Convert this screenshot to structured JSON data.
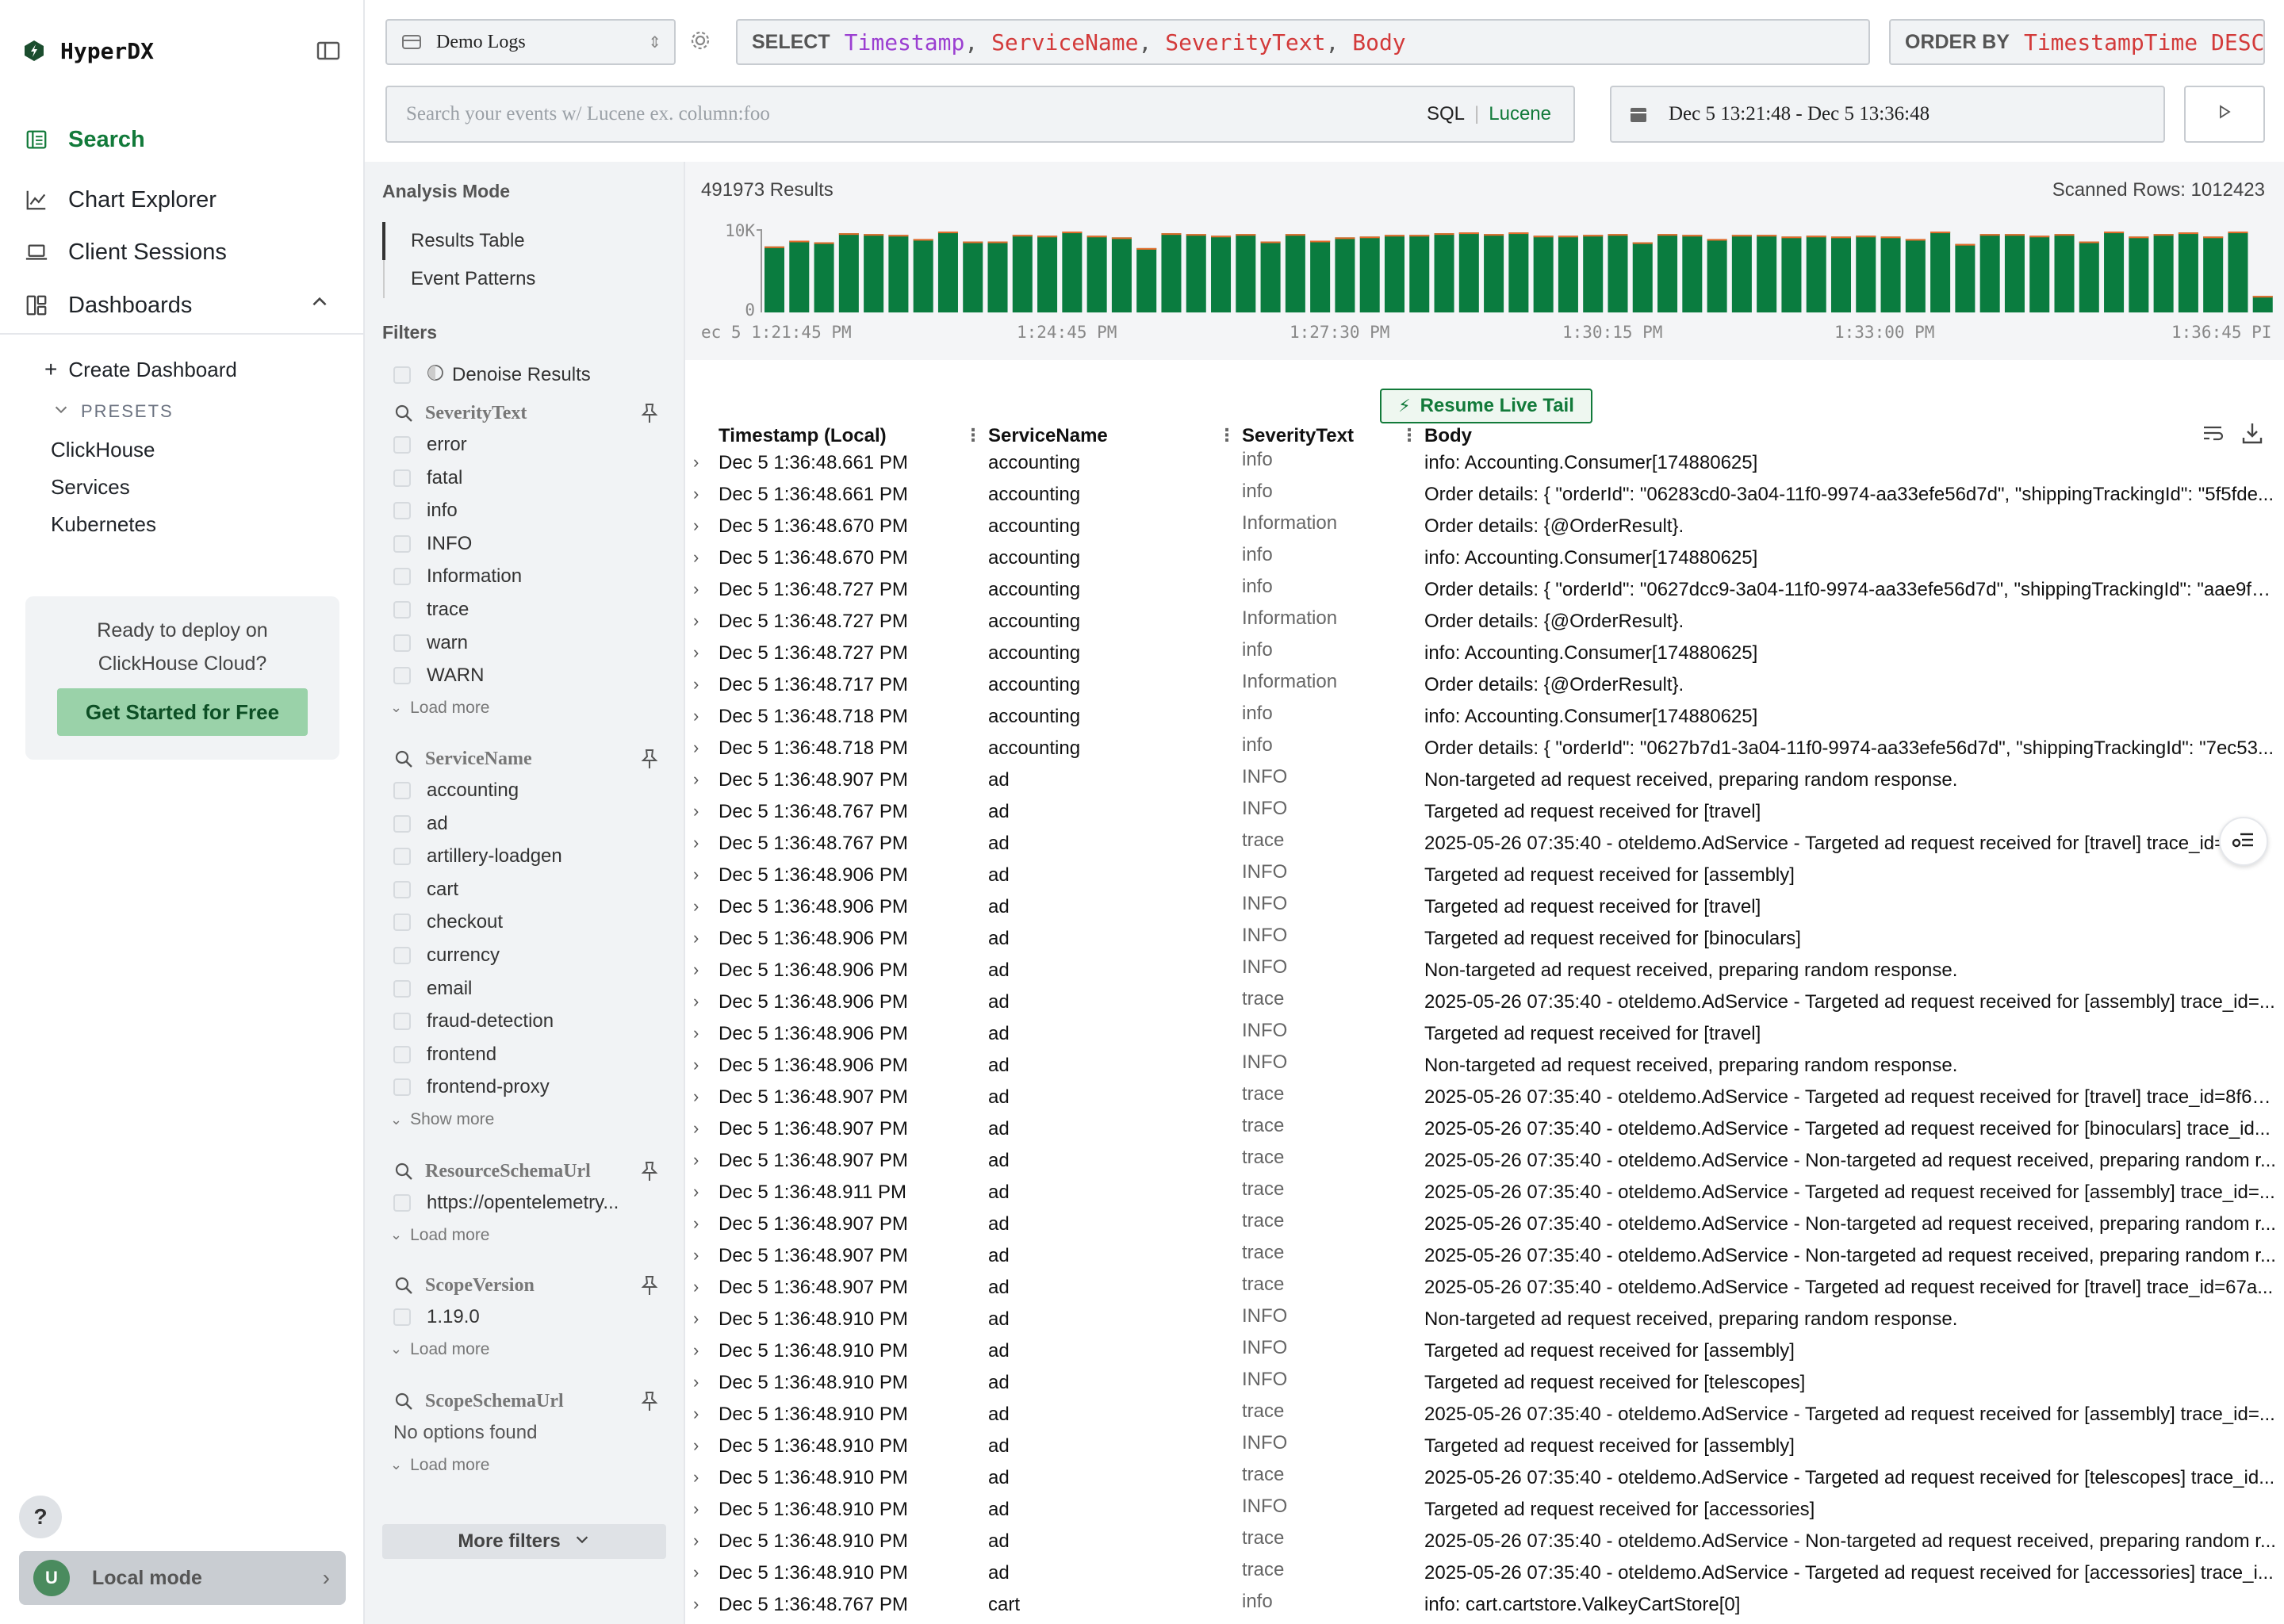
{
  "app": {
    "name": "HyperDX"
  },
  "nav": {
    "items": [
      {
        "label": "Search",
        "active": true
      },
      {
        "label": "Chart Explorer"
      },
      {
        "label": "Client Sessions"
      },
      {
        "label": "Dashboards"
      }
    ],
    "create_dashboard": "Create Dashboard",
    "presets_label": "PRESETS",
    "presets": [
      "ClickHouse",
      "Services",
      "Kubernetes"
    ],
    "deploy_card": {
      "line1": "Ready to deploy on",
      "line2": "ClickHouse Cloud?",
      "button": "Get Started for Free"
    },
    "help": "?",
    "local_mode": {
      "avatar": "U",
      "label": "Local mode"
    }
  },
  "query": {
    "source": "Demo Logs",
    "select_kw": "SELECT",
    "select_fields": [
      "Timestamp",
      "ServiceName",
      "SeverityText",
      "Body"
    ],
    "order_kw": "ORDER BY",
    "order_value": "TimestampTime DESC",
    "search_placeholder": "Search your events w/ Lucene ex. column:foo",
    "lang_sql": "SQL",
    "lang_lucene": "Lucene",
    "time_range": "Dec 5 13:21:48 - Dec 5 13:36:48"
  },
  "filters": {
    "analysis_mode_label": "Analysis Mode",
    "modes": [
      "Results Table",
      "Event Patterns"
    ],
    "filters_label": "Filters",
    "denoise": "Denoise Results",
    "groups": [
      {
        "name": "SeverityText",
        "values": [
          "error",
          "fatal",
          "info",
          "INFO",
          "Information",
          "trace",
          "warn",
          "WARN"
        ],
        "more": "Load more"
      },
      {
        "name": "ServiceName",
        "values": [
          "accounting",
          "ad",
          "artillery-loadgen",
          "cart",
          "checkout",
          "currency",
          "email",
          "fraud-detection",
          "frontend",
          "frontend-proxy"
        ],
        "more": "Show more"
      },
      {
        "name": "ResourceSchemaUrl",
        "values": [
          "https://opentelemetry..."
        ],
        "more": "Load more"
      },
      {
        "name": "ScopeVersion",
        "values": [
          "1.19.0"
        ],
        "more": "Load more"
      },
      {
        "name": "ScopeSchemaUrl",
        "values": [],
        "empty": "No options found",
        "more": "Load more"
      }
    ],
    "more_filters": "More filters"
  },
  "results": {
    "count": "491973 Results",
    "scanned": "Scanned Rows: 1012423",
    "live_tail": "Resume Live Tail",
    "columns": [
      "Timestamp (Local)",
      "ServiceName",
      "SeverityText",
      "Body"
    ]
  },
  "chart_data": {
    "type": "bar",
    "y_tick_labels": [
      "10K",
      "0"
    ],
    "ylim": [
      0,
      10000
    ],
    "x_tick_labels": [
      "ec 5 1:21:45 PM",
      "1:24:45 PM",
      "1:27:30 PM",
      "1:30:15 PM",
      "1:33:00 PM",
      "1:36:45 PI"
    ],
    "values": [
      8000,
      8700,
      8500,
      9600,
      9500,
      9400,
      8900,
      9800,
      8600,
      8600,
      9400,
      9300,
      9800,
      9300,
      9100,
      7800,
      9600,
      9500,
      9300,
      9500,
      8600,
      9500,
      8700,
      9100,
      9200,
      9400,
      9400,
      9600,
      9700,
      9500,
      9700,
      9300,
      9300,
      9400,
      9500,
      8500,
      9500,
      9400,
      8900,
      9400,
      9400,
      9200,
      9300,
      9200,
      9300,
      9200,
      8900,
      9800,
      8300,
      9500,
      9500,
      9300,
      9500,
      8600,
      9800,
      9200,
      9500,
      9700,
      9200,
      9800,
      2000
    ],
    "bar_color": "#0a7c3f",
    "top_color": "#e86b2a"
  },
  "rows": [
    {
      "ts": "Dec 5 1:36:48.661 PM",
      "svc": "accounting",
      "sev": "info",
      "body": "info: Accounting.Consumer[174880625]"
    },
    {
      "ts": "Dec 5 1:36:48.661 PM",
      "svc": "accounting",
      "sev": "info",
      "body": "Order details: { \"orderId\": \"06283cd0-3a04-11f0-9974-aa33efe56d7d\", \"shippingTrackingId\": \"5f5fde..."
    },
    {
      "ts": "Dec 5 1:36:48.670 PM",
      "svc": "accounting",
      "sev": "Information",
      "body": "Order details: {@OrderResult}."
    },
    {
      "ts": "Dec 5 1:36:48.670 PM",
      "svc": "accounting",
      "sev": "info",
      "body": "info: Accounting.Consumer[174880625]"
    },
    {
      "ts": "Dec 5 1:36:48.727 PM",
      "svc": "accounting",
      "sev": "info",
      "body": "Order details: { \"orderId\": \"0627dcc9-3a04-11f0-9974-aa33efe56d7d\", \"shippingTrackingId\": \"aae9fa..."
    },
    {
      "ts": "Dec 5 1:36:48.727 PM",
      "svc": "accounting",
      "sev": "Information",
      "body": "Order details: {@OrderResult}."
    },
    {
      "ts": "Dec 5 1:36:48.727 PM",
      "svc": "accounting",
      "sev": "info",
      "body": "info: Accounting.Consumer[174880625]"
    },
    {
      "ts": "Dec 5 1:36:48.717 PM",
      "svc": "accounting",
      "sev": "Information",
      "body": "Order details: {@OrderResult}."
    },
    {
      "ts": "Dec 5 1:36:48.718 PM",
      "svc": "accounting",
      "sev": "info",
      "body": "info: Accounting.Consumer[174880625]"
    },
    {
      "ts": "Dec 5 1:36:48.718 PM",
      "svc": "accounting",
      "sev": "info",
      "body": "Order details: { \"orderId\": \"0627b7d1-3a04-11f0-9974-aa33efe56d7d\", \"shippingTrackingId\": \"7ec53..."
    },
    {
      "ts": "Dec 5 1:36:48.907 PM",
      "svc": "ad",
      "sev": "INFO",
      "body": "Non-targeted ad request received, preparing random response."
    },
    {
      "ts": "Dec 5 1:36:48.767 PM",
      "svc": "ad",
      "sev": "INFO",
      "body": "Targeted ad request received for [travel]"
    },
    {
      "ts": "Dec 5 1:36:48.767 PM",
      "svc": "ad",
      "sev": "trace",
      "body": "2025-05-26 07:35:40 - oteldemo.AdService - Targeted ad request received for [travel] trace_id=..."
    },
    {
      "ts": "Dec 5 1:36:48.906 PM",
      "svc": "ad",
      "sev": "INFO",
      "body": "Targeted ad request received for [assembly]"
    },
    {
      "ts": "Dec 5 1:36:48.906 PM",
      "svc": "ad",
      "sev": "INFO",
      "body": "Targeted ad request received for [travel]"
    },
    {
      "ts": "Dec 5 1:36:48.906 PM",
      "svc": "ad",
      "sev": "INFO",
      "body": "Targeted ad request received for [binoculars]"
    },
    {
      "ts": "Dec 5 1:36:48.906 PM",
      "svc": "ad",
      "sev": "INFO",
      "body": "Non-targeted ad request received, preparing random response."
    },
    {
      "ts": "Dec 5 1:36:48.906 PM",
      "svc": "ad",
      "sev": "trace",
      "body": "2025-05-26 07:35:40 - oteldemo.AdService - Targeted ad request received for [assembly] trace_id=..."
    },
    {
      "ts": "Dec 5 1:36:48.906 PM",
      "svc": "ad",
      "sev": "INFO",
      "body": "Targeted ad request received for [travel]"
    },
    {
      "ts": "Dec 5 1:36:48.906 PM",
      "svc": "ad",
      "sev": "INFO",
      "body": "Non-targeted ad request received, preparing random response."
    },
    {
      "ts": "Dec 5 1:36:48.907 PM",
      "svc": "ad",
      "sev": "trace",
      "body": "2025-05-26 07:35:40 - oteldemo.AdService - Targeted ad request received for [travel] trace_id=8f6a..."
    },
    {
      "ts": "Dec 5 1:36:48.907 PM",
      "svc": "ad",
      "sev": "trace",
      "body": "2025-05-26 07:35:40 - oteldemo.AdService - Targeted ad request received for [binoculars] trace_id..."
    },
    {
      "ts": "Dec 5 1:36:48.907 PM",
      "svc": "ad",
      "sev": "trace",
      "body": "2025-05-26 07:35:40 - oteldemo.AdService - Non-targeted ad request received, preparing random r..."
    },
    {
      "ts": "Dec 5 1:36:48.911 PM",
      "svc": "ad",
      "sev": "trace",
      "body": "2025-05-26 07:35:40 - oteldemo.AdService - Targeted ad request received for [assembly] trace_id=..."
    },
    {
      "ts": "Dec 5 1:36:48.907 PM",
      "svc": "ad",
      "sev": "trace",
      "body": "2025-05-26 07:35:40 - oteldemo.AdService - Non-targeted ad request received, preparing random r..."
    },
    {
      "ts": "Dec 5 1:36:48.907 PM",
      "svc": "ad",
      "sev": "trace",
      "body": "2025-05-26 07:35:40 - oteldemo.AdService - Non-targeted ad request received, preparing random r..."
    },
    {
      "ts": "Dec 5 1:36:48.907 PM",
      "svc": "ad",
      "sev": "trace",
      "body": "2025-05-26 07:35:40 - oteldemo.AdService - Targeted ad request received for [travel] trace_id=67a..."
    },
    {
      "ts": "Dec 5 1:36:48.910 PM",
      "svc": "ad",
      "sev": "INFO",
      "body": "Non-targeted ad request received, preparing random response."
    },
    {
      "ts": "Dec 5 1:36:48.910 PM",
      "svc": "ad",
      "sev": "INFO",
      "body": "Targeted ad request received for [assembly]"
    },
    {
      "ts": "Dec 5 1:36:48.910 PM",
      "svc": "ad",
      "sev": "INFO",
      "body": "Targeted ad request received for [telescopes]"
    },
    {
      "ts": "Dec 5 1:36:48.910 PM",
      "svc": "ad",
      "sev": "trace",
      "body": "2025-05-26 07:35:40 - oteldemo.AdService - Targeted ad request received for [assembly] trace_id=..."
    },
    {
      "ts": "Dec 5 1:36:48.910 PM",
      "svc": "ad",
      "sev": "INFO",
      "body": "Targeted ad request received for [assembly]"
    },
    {
      "ts": "Dec 5 1:36:48.910 PM",
      "svc": "ad",
      "sev": "trace",
      "body": "2025-05-26 07:35:40 - oteldemo.AdService - Targeted ad request received for [telescopes] trace_id..."
    },
    {
      "ts": "Dec 5 1:36:48.910 PM",
      "svc": "ad",
      "sev": "INFO",
      "body": "Targeted ad request received for [accessories]"
    },
    {
      "ts": "Dec 5 1:36:48.910 PM",
      "svc": "ad",
      "sev": "trace",
      "body": "2025-05-26 07:35:40 - oteldemo.AdService - Non-targeted ad request received, preparing random r..."
    },
    {
      "ts": "Dec 5 1:36:48.910 PM",
      "svc": "ad",
      "sev": "trace",
      "body": "2025-05-26 07:35:40 - oteldemo.AdService - Targeted ad request received for [accessories] trace_i..."
    },
    {
      "ts": "Dec 5 1:36:48.767 PM",
      "svc": "cart",
      "sev": "info",
      "body": "info: cart.cartstore.ValkeyCartStore[0]"
    }
  ]
}
